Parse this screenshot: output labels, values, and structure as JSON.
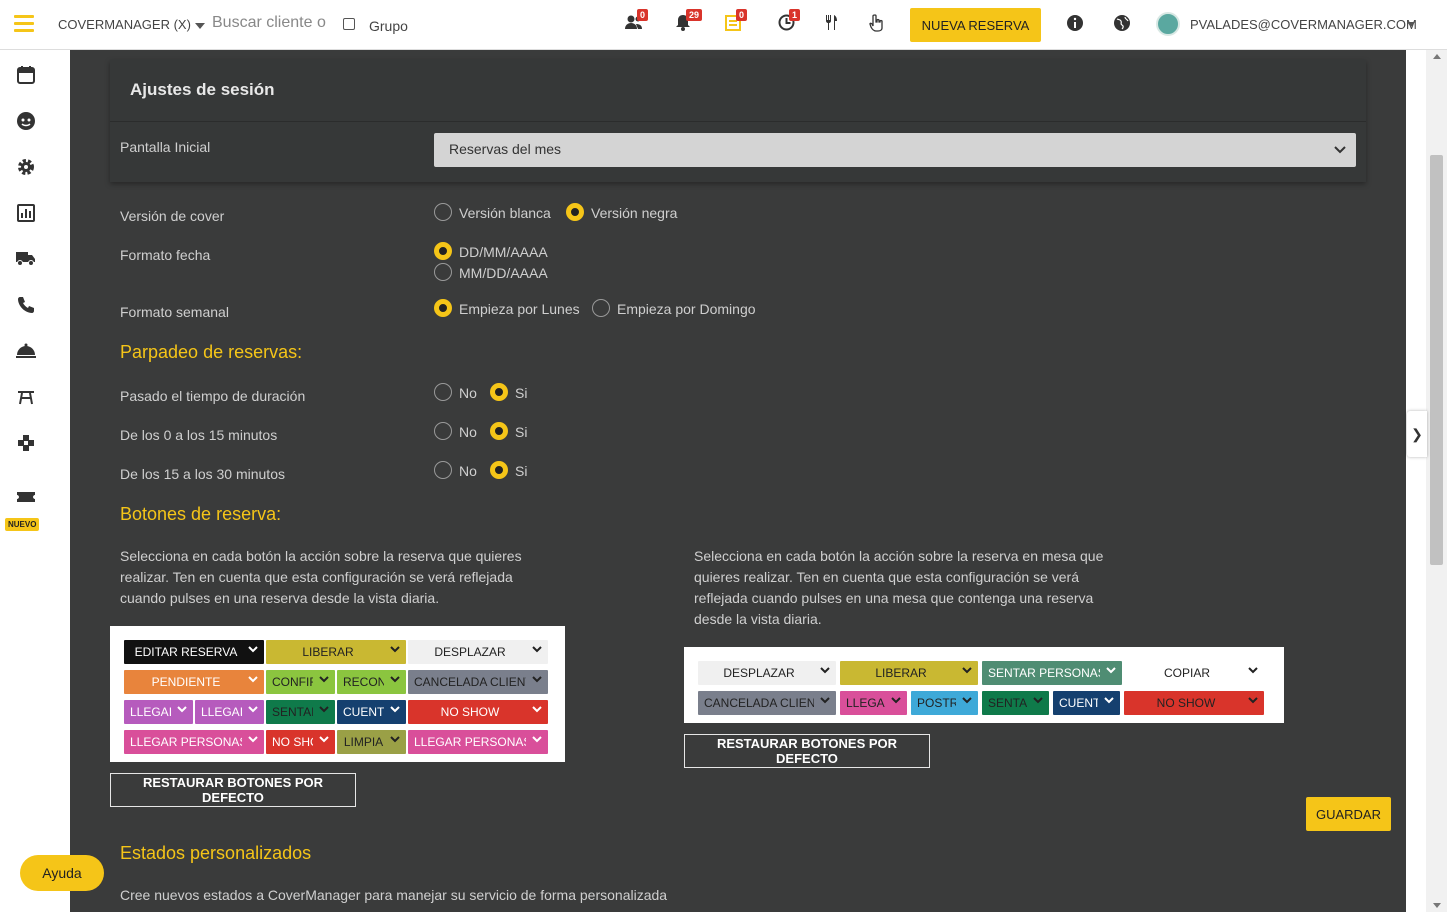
{
  "topbar": {
    "venue": "COVERMANAGER (X)",
    "search_placeholder": "Buscar cliente o",
    "grupo_label": "Grupo",
    "badges": {
      "users": "0",
      "bell": "29",
      "notes": "0",
      "clock": "1"
    },
    "nueva_reserva": "NUEVA RESERVA",
    "user_email": "PVALADES@COVERMANAGER.COM"
  },
  "sidebar": {
    "nuevo_badge": "NUEVO"
  },
  "session": {
    "title": "Ajustes de sesión",
    "pantalla_inicial_label": "Pantalla Inicial",
    "pantalla_inicial_value": "Reservas del mes",
    "version_cover_label": "Versión de cover",
    "version_blanca": "Versión blanca",
    "version_negra": "Versión negra",
    "formato_fecha_label": "Formato fecha",
    "fecha_ddmm": "DD/MM/AAAA",
    "fecha_mmdd": "MM/DD/AAAA",
    "formato_semanal_label": "Formato semanal",
    "empieza_lunes": "Empieza por Lunes",
    "empieza_domingo": "Empieza por Domingo"
  },
  "parpadeo": {
    "title": "Parpadeo de reservas:",
    "rows": [
      {
        "label": "Pasado el tiempo de duración",
        "no": "No",
        "si": "Si"
      },
      {
        "label": "De los 0 a los 15 minutos",
        "no": "No",
        "si": "Si"
      },
      {
        "label": "De los 15 a los 30 minutos",
        "no": "No",
        "si": "Si"
      }
    ]
  },
  "botones": {
    "title": "Botones de reserva:",
    "desc_left": "Selecciona en cada botón la acción sobre la reserva que quieres realizar. Ten en cuenta que esta configuración se verá reflejada cuando pulses en una reserva desde la vista diaria.",
    "desc_right": "Selecciona en cada botón la acción sobre la reserva en mesa que quieres realizar. Ten en cuenta que esta configuración se verá reflejada cuando pulses en una mesa que contenga una reserva desde la vista diaria.",
    "left_buttons": [
      {
        "label": "EDITAR RESERVA",
        "color": "#111111",
        "text": "#ffffff"
      },
      {
        "label": "LIBERAR",
        "color": "#c9b832",
        "text": "#222222"
      },
      {
        "label": "DESPLAZAR",
        "color": "#f0f0f0",
        "text": "#222222"
      },
      {
        "label": "PENDIENTE",
        "color": "#e8843c",
        "text": "#ffffff"
      },
      {
        "label": "CONFIR",
        "color": "#8bc53f",
        "text": "#222222"
      },
      {
        "label": "RECON",
        "color": "#8bc53f",
        "text": "#222222"
      },
      {
        "label": "CANCELADA CLIENTE",
        "color": "#7a7f8c",
        "text": "#222222"
      },
      {
        "label": "LLEGAI",
        "color": "#b65bbd",
        "text": "#ffffff"
      },
      {
        "label": "LLEGAI",
        "color": "#b65bbd",
        "text": "#ffffff"
      },
      {
        "label": "SENTAI",
        "color": "#0f7a4a",
        "text": "#222222"
      },
      {
        "label": "CUENT.",
        "color": "#15406f",
        "text": "#ffffff"
      },
      {
        "label": "NO SHOW",
        "color": "#d9342b",
        "text": "#ffffff"
      },
      {
        "label": "LLEGAR PERSONAS",
        "color": "#d94f9a",
        "text": "#ffffff"
      },
      {
        "label": "NO SHO",
        "color": "#d9342b",
        "text": "#ffffff"
      },
      {
        "label": "LIMPIA",
        "color": "#9aa046",
        "text": "#222222"
      },
      {
        "label": "LLEGAR PERSONAS",
        "color": "#d94f9a",
        "text": "#ffffff"
      }
    ],
    "right_buttons": [
      {
        "label": "DESPLAZAR",
        "color": "#f0f0f0",
        "text": "#222222"
      },
      {
        "label": "LIBERAR",
        "color": "#c9b832",
        "text": "#222222"
      },
      {
        "label": "SENTAR PERSONAS",
        "color": "#4f8d73",
        "text": "#ffffff"
      },
      {
        "label": "COPIAR",
        "color": "#ffffff",
        "text": "#222222"
      },
      {
        "label": "CANCELADA CLIENTE",
        "color": "#7a7f8c",
        "text": "#222222"
      },
      {
        "label": "LLEGAI",
        "color": "#d94f9a",
        "text": "#222222"
      },
      {
        "label": "POSTR",
        "color": "#3ea9d8",
        "text": "#222222"
      },
      {
        "label": "SENTAI",
        "color": "#0f7a4a",
        "text": "#222222"
      },
      {
        "label": "CUENT.",
        "color": "#15406f",
        "text": "#ffffff"
      },
      {
        "label": "NO SHOW",
        "color": "#d9342b",
        "text": "#222222"
      }
    ],
    "restore_left": "RESTAURAR BOTONES POR DEFECTO",
    "restore_right": "RESTAURAR BOTONES POR DEFECTO",
    "guardar": "GUARDAR"
  },
  "estados": {
    "title": "Estados personalizados",
    "desc": "Cree nuevos estados a CoverManager para manejar su servicio de forma personalizada"
  },
  "ayuda": "Ayuda",
  "colors": {
    "accent": "#f5c518",
    "panel": "#3a3b3b"
  }
}
